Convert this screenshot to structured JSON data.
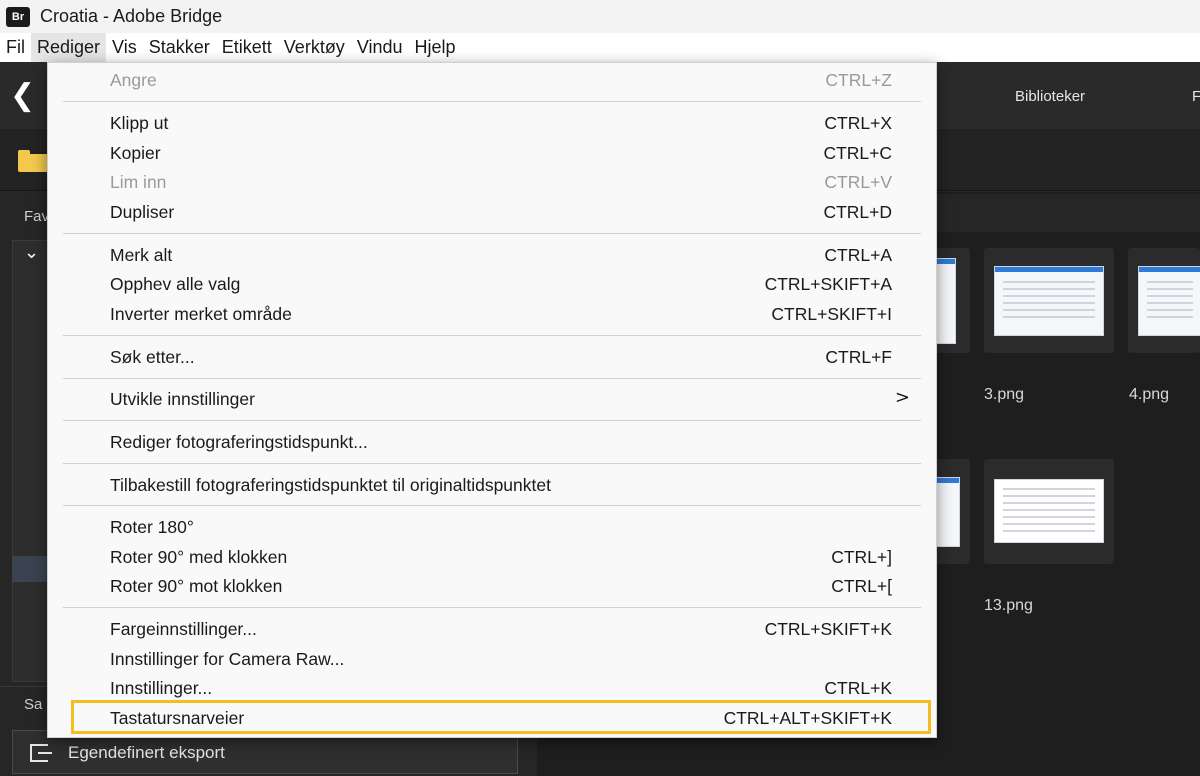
{
  "window": {
    "title": "Croatia - Adobe Bridge",
    "app_icon": "Br"
  },
  "menubar": [
    "Fil",
    "Rediger",
    "Vis",
    "Stakker",
    "Etikett",
    "Verktøy",
    "Vindu",
    "Hjelp"
  ],
  "active_menu": "Rediger",
  "toolbar": {
    "tab_libraries": "Biblioteker",
    "tab_cut": "F"
  },
  "left_panel": {
    "favorites_label": "Fav",
    "section_label": "Sa",
    "export_label": "Egendefinert eksport"
  },
  "thumbnails": [
    {
      "label": "3.png"
    },
    {
      "label": "4.png"
    },
    {
      "label": "13.png"
    }
  ],
  "edit_menu": [
    {
      "label": "Angre",
      "shortcut": "CTRL+Z",
      "disabled": true
    },
    {
      "label": "Klipp ut",
      "shortcut": "CTRL+X"
    },
    {
      "label": "Kopier",
      "shortcut": "CTRL+C"
    },
    {
      "label": "Lim inn",
      "shortcut": "CTRL+V",
      "disabled": true
    },
    {
      "label": "Dupliser",
      "shortcut": "CTRL+D"
    },
    {
      "label": "Merk alt",
      "shortcut": "CTRL+A"
    },
    {
      "label": "Opphev alle valg",
      "shortcut": "CTRL+SKIFT+A"
    },
    {
      "label": "Inverter merket område",
      "shortcut": "CTRL+SKIFT+I"
    },
    {
      "label": "Søk etter...",
      "shortcut": "CTRL+F"
    },
    {
      "label": "Utvikle innstillinger",
      "shortcut": "",
      "submenu": ">"
    },
    {
      "label": "Rediger fotograferingstidspunkt...",
      "shortcut": ""
    },
    {
      "label": "Tilbakestill fotograferingstidspunktet til originaltidspunktet",
      "shortcut": ""
    },
    {
      "label": "Roter 180°",
      "shortcut": ""
    },
    {
      "label": "Roter 90° med klokken",
      "shortcut": "CTRL+]"
    },
    {
      "label": "Roter 90° mot klokken",
      "shortcut": "CTRL+["
    },
    {
      "label": "Fargeinnstillinger...",
      "shortcut": "CTRL+SKIFT+K"
    },
    {
      "label": "Innstillinger for Camera Raw...",
      "shortcut": ""
    },
    {
      "label": "Innstillinger...",
      "shortcut": "CTRL+K"
    },
    {
      "label": "Tastatursnarveier",
      "shortcut": "CTRL+ALT+SKIFT+K",
      "highlighted": true
    }
  ],
  "colors": {
    "highlight_border": "#f5bd1f",
    "menu_bg": "#f9f9f9",
    "app_bg": "#262626"
  }
}
